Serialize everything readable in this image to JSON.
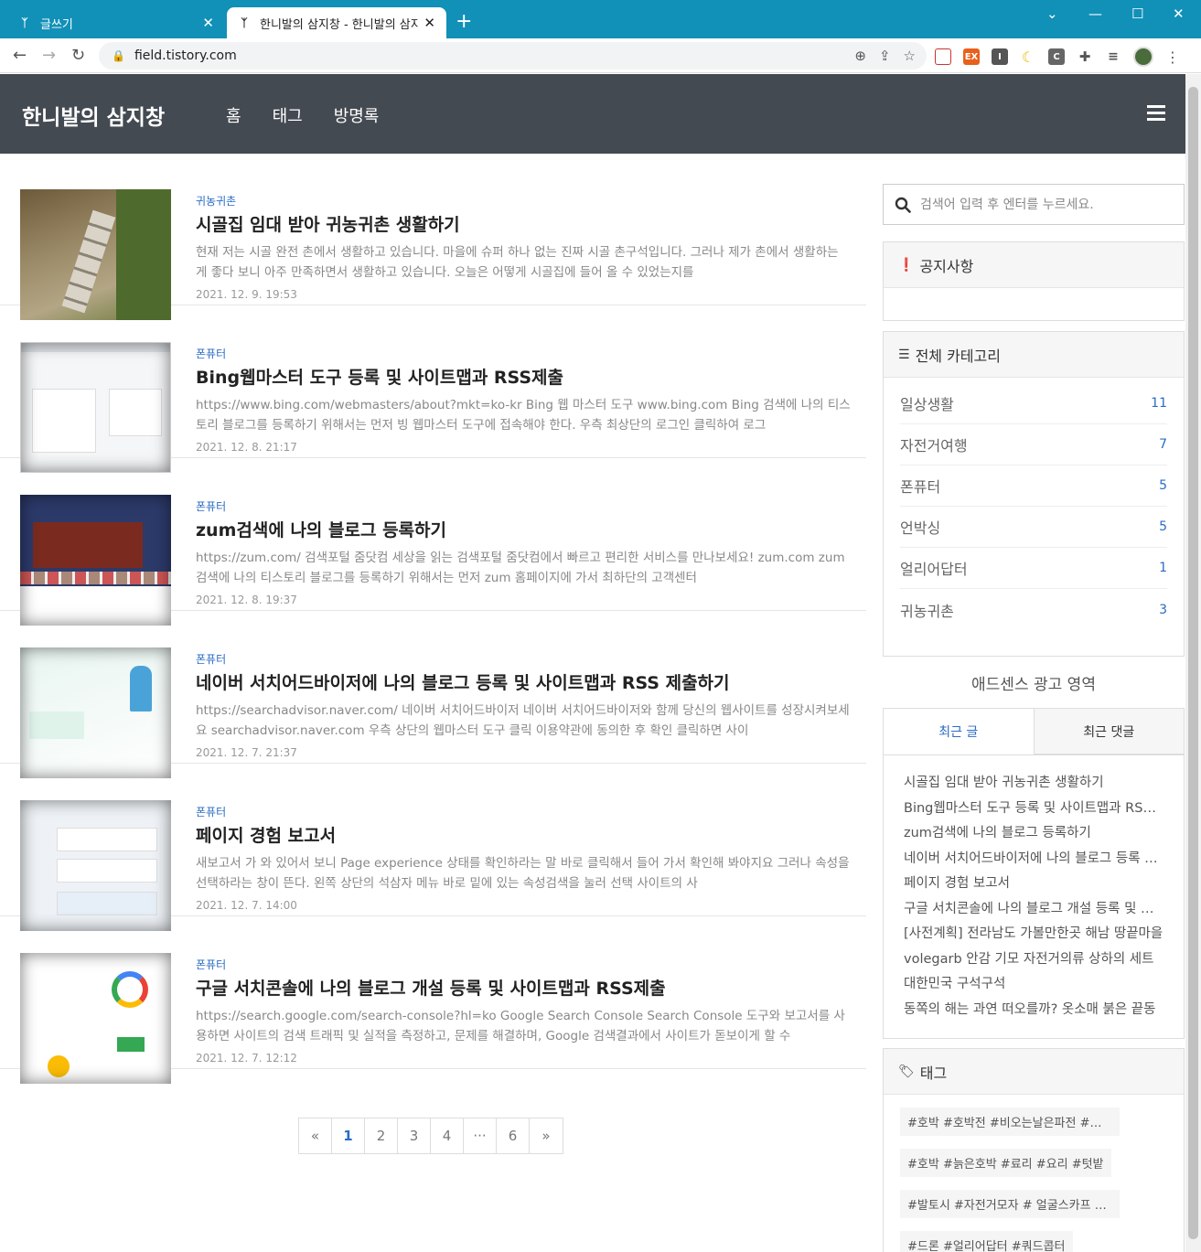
{
  "browser": {
    "tabs": [
      {
        "title": "글쓰기",
        "active": false
      },
      {
        "title": "한니발의 삼지창 - 한니발의 삼지창",
        "active": true
      }
    ],
    "new_tab": "+",
    "url": "field.tistory.com",
    "accent": "#1190b8"
  },
  "site": {
    "title": "한니발의 삼지창",
    "nav": [
      "홈",
      "태그",
      "방명록"
    ]
  },
  "posts": [
    {
      "category": "귀농귀촌",
      "title": "시골집 임대 받아 귀농귀촌 생활하기",
      "excerpt": "현재 저는 시골 완전 촌에서 생활하고 있습니다. 마을에 슈퍼 하나 없는 진짜 시골 촌구석입니다. 그러나 제가 촌에서 생활하는 게 좋다 보니 아주 만족하면서 생활하고 있습니다. 오늘은 어떻게 시골집에 들어 올 수 있었는지를",
      "date": "2021. 12. 9. 19:53"
    },
    {
      "category": "폰퓨터",
      "title": "Bing웹마스터 도구 등록 및 사이트맵과 RSS제출",
      "excerpt": "https://www.bing.com/webmasters/about?mkt=ko-kr Bing 웹 마스터 도구 www.bing.com Bing 검색에 나의 티스토리 블로그를 등록하기 위해서는 먼저 빙 웹마스터 도구에 접속해야 한다. 우측 최상단의 로그인 클릭하여 로그",
      "date": "2021. 12. 8. 21:17"
    },
    {
      "category": "폰퓨터",
      "title": "zum검색에 나의 블로그 등록하기",
      "excerpt": "https://zum.com/ 검색포털 줌닷컴 세상을 읽는 검색포털 줌닷컴에서 빠르고 편리한 서비스를 만나보세요! zum.com zum 검색에 나의 티스토리 블로그를 등록하기 위해서는 먼저 zum 홈페이지에 가서 최하단의 고객센터",
      "date": "2021. 12. 8. 19:37"
    },
    {
      "category": "폰퓨터",
      "title": "네이버 서치어드바이저에 나의 블로그 등록 및 사이트맵과 RSS 제출하기",
      "excerpt": "https://searchadvisor.naver.com/ 네이버 서치어드바이저 네이버 서치어드바이저와 함께 당신의 웹사이트를 성장시켜보세요 searchadvisor.naver.com 우측 상단의 웹마스터 도구 클릭 이용약관에 동의한 후 확인 클릭하면 사이",
      "date": "2021. 12. 7. 21:37"
    },
    {
      "category": "폰퓨터",
      "title": "페이지 경험 보고서",
      "excerpt": "새보고서 가 와 있어서 보니 Page experience 상태를 확인하라는 말 바로 클릭해서 들어 가서 확인해 봐야지요 그러나 속성을 선택하라는 창이 뜬다. 왼쪽 상단의 석삼자 메뉴 바로 밑에 있는 속성검색을 눌러 선택 사이트의 사",
      "date": "2021. 12. 7. 14:00"
    },
    {
      "category": "폰퓨터",
      "title": "구글 서치콘솔에 나의 블로그 개설 등록 및 사이트맵과 RSS제출",
      "excerpt": "https://search.google.com/search-console?hl=ko Google Search Console Search Console 도구와 보고서를 사용하면 사이트의 검색 트래픽 및 실적을 측정하고, 문제를 해결하며, Google 검색결과에서 사이트가 돋보이게 할 수",
      "date": "2021. 12. 7. 12:12"
    }
  ],
  "pagination": [
    "«",
    "1",
    "2",
    "3",
    "4",
    "···",
    "6",
    "»"
  ],
  "sidebar": {
    "search_placeholder": "검색어 입력 후 엔터를 누르세요.",
    "notice_title": "공지사항",
    "category_title": "전체 카테고리",
    "categories": [
      {
        "name": "일상생활",
        "count": "11"
      },
      {
        "name": "자전거여행",
        "count": "7"
      },
      {
        "name": "폰퓨터",
        "count": "5"
      },
      {
        "name": "언박싱",
        "count": "5"
      },
      {
        "name": "얼리어답터",
        "count": "1"
      },
      {
        "name": "귀농귀촌",
        "count": "3"
      }
    ],
    "adsense": "애드센스 광고 영역",
    "tab_recent_posts": "최근 글",
    "tab_recent_comments": "최근 댓글",
    "recent_posts": [
      "시골집 임대 받아 귀농귀촌 생활하기",
      "Bing웹마스터 도구 등록 및 사이트맵과 RSS제출",
      "zum검색에 나의 블로그 등록하기",
      "네이버 서치어드바이저에 나의 블로그 등록 및 사이트맵과 RSS 제출하기",
      "페이지 경험 보고서",
      "구글 서치콘솔에 나의 블로그 개설 등록 및 사이트맵과 RSS제출",
      "[사전계획] 전라남도 가볼만한곳 해남 땅끝마을",
      "volegarb 안감 기모 자전거의류 상하의 세트",
      "대한민국 구석구석",
      "동쪽의 해는 과연 떠오를까? 옷소매 붉은 끝동"
    ],
    "tag_title": "태그",
    "tags": [
      "#호박 #호박전 #비오는날은파전 #비오는날",
      "#호박 #늙은호박 #료리 #요리 #텃밭",
      "#발토시 #자전거모자 # 얼굴스카프 #자전거",
      "#드론 #얼리어답터 #쿼드콥터"
    ]
  },
  "colors": {
    "header_bg": "#444a52",
    "link": "#2b6cc4"
  }
}
